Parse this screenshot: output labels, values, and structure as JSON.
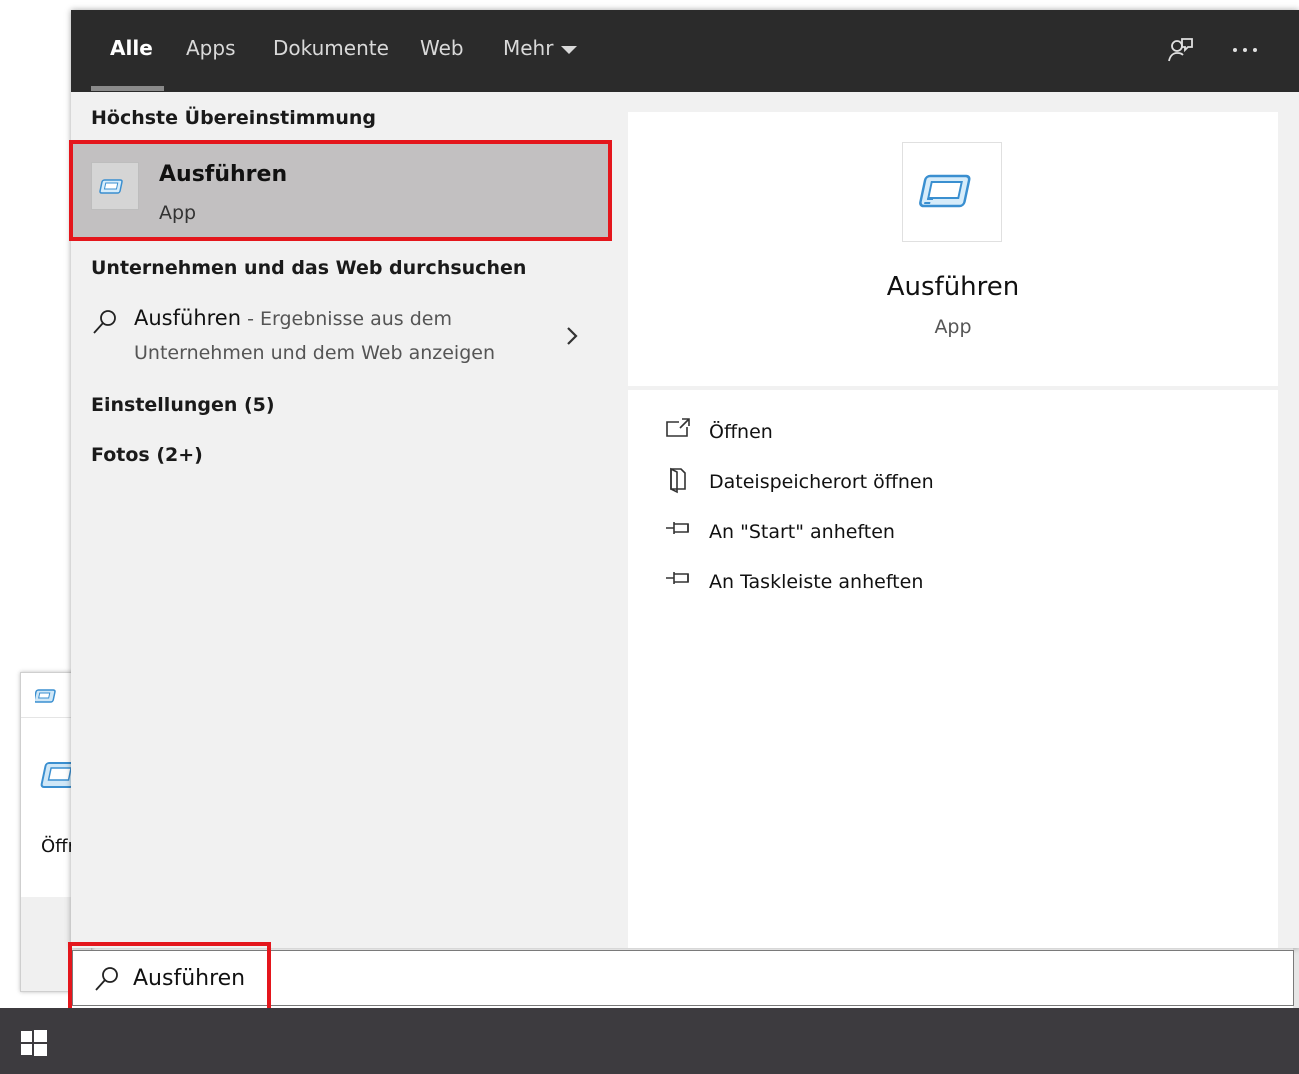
{
  "tabs": {
    "items": [
      {
        "label": "Alle",
        "active": true
      },
      {
        "label": "Apps",
        "active": false
      },
      {
        "label": "Dokumente",
        "active": false
      },
      {
        "label": "Web",
        "active": false
      },
      {
        "label": "Mehr",
        "active": false
      }
    ],
    "feedback_icon": "feedback-icon",
    "more_icon": "more-options-icon"
  },
  "left": {
    "best_match_heading": "Höchste Übereinstimmung",
    "best_match": {
      "title": "Ausführen",
      "subtitle": "App",
      "icon": "run-app-icon"
    },
    "web_heading": "Unternehmen und das Web durchsuchen",
    "web_result": {
      "term": "Ausführen",
      "suffix": " - Ergebnisse aus dem",
      "line2": "Unternehmen und dem Web anzeigen"
    },
    "settings_heading": "Einstellungen (5)",
    "photos_heading": "Fotos (2+)"
  },
  "preview": {
    "title": "Ausführen",
    "subtitle": "App",
    "actions": [
      {
        "label": "Öffnen",
        "icon": "open-icon"
      },
      {
        "label": "Dateispeicherort öffnen",
        "icon": "file-location-icon"
      },
      {
        "label": "An \"Start\" anheften",
        "icon": "pin-icon"
      },
      {
        "label": "An Taskleiste anheften",
        "icon": "pin-icon"
      }
    ]
  },
  "search": {
    "value": "Ausführen"
  },
  "background_window": {
    "button_text": "Öffr"
  },
  "colors": {
    "highlight_border": "#e4161c",
    "tabbar": "#2b2b2b",
    "taskbar": "#3d3b3f",
    "selected_row": "#c2c0c1"
  }
}
